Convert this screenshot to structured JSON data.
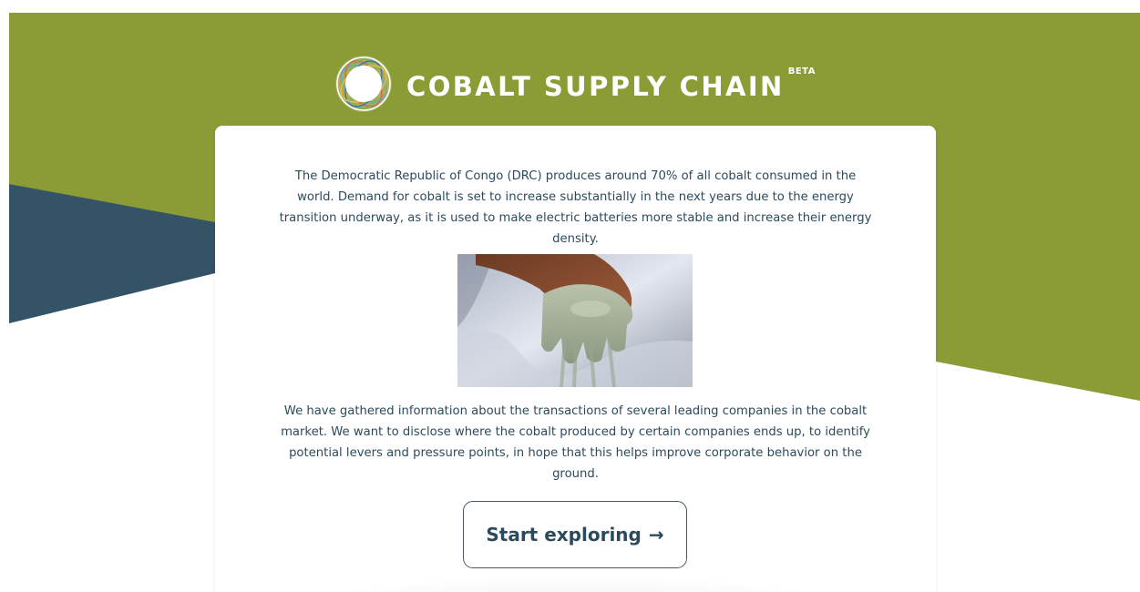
{
  "header": {
    "title": "COBALT SUPPLY CHAIN",
    "badge": "BETA",
    "logo_icon": "circular-ring-logo-icon"
  },
  "main": {
    "intro": "The Democratic Republic of Congo (DRC) produces around 70% of all cobalt consumed in the world. Demand for cobalt is set to increase substantially in the next years due to the energy transition underway, as it is used to make electric batteries more stable and increase their energy density.",
    "image_subject": "hand-holding-cobalt-ore",
    "info": "We have gathered information about the transactions of several leading companies in the cobalt market. We want to disclose where the cobalt produced by certain companies ends up, to identify potential levers and pressure points, in hope that this helps improve corporate behavior on the ground.",
    "cta": {
      "label": "Start exploring",
      "arrow": "→"
    }
  },
  "colors": {
    "olive_green": "#8b9c36",
    "dark_slate": "#355366",
    "text_navy": "#2d4a5d",
    "white": "#ffffff"
  }
}
